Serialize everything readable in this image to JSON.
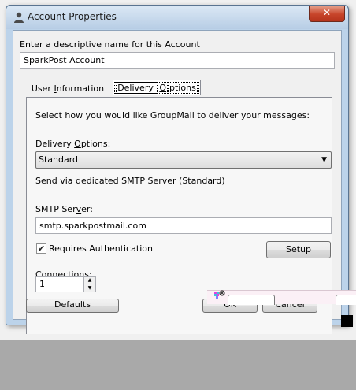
{
  "window": {
    "title": "Account Properties",
    "close_symbol": "✕"
  },
  "account": {
    "prompt": "Enter a descriptive name for this Account",
    "name_value": "SparkPost Account"
  },
  "tabs": {
    "user_info": {
      "pre": "User ",
      "u": "I",
      "post": "nformation"
    },
    "delivery_options": {
      "pre": "Delivery ",
      "u": "O",
      "post": "ptions"
    }
  },
  "delivery": {
    "intro": "Select how you would like GroupMail to deliver your messages:",
    "options_label": {
      "pre": "Delivery ",
      "u": "O",
      "post": "ptions:"
    },
    "selected_option": "Standard",
    "description": "Send via dedicated SMTP Server (Standard)",
    "smtp_label": {
      "pre": "SMTP Ser",
      "u": "v",
      "post": "er:"
    },
    "smtp_value": "smtp.sparkpostmail.com",
    "requires_auth_label": "Requires Authentication",
    "requires_auth_checked": true,
    "setup_label": "Setup",
    "connections_label": {
      "pre": "Conn",
      "u": "e",
      "post": "ctions:"
    },
    "connections_value": "1"
  },
  "buttons": {
    "defaults": "Defaults",
    "ok": "OK",
    "cancel": "Cancel"
  }
}
